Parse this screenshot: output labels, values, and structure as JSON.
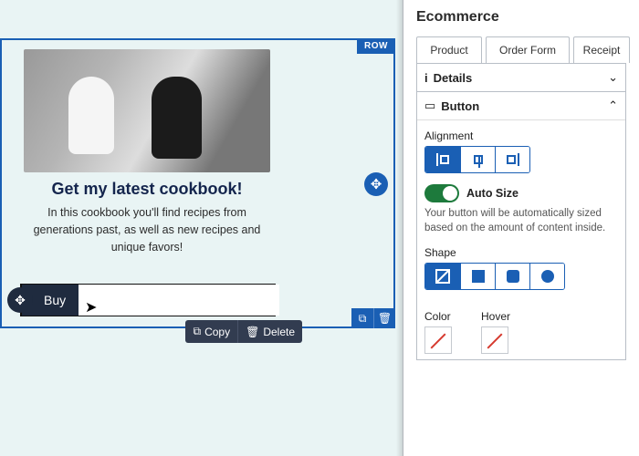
{
  "canvas": {
    "row_tag": "ROW",
    "headline": "Get my latest cookbook!",
    "subtext": "In this cookbook you'll find recipes from generations past, as well as new recipes and unique favors!",
    "buy_label": "Buy",
    "copy_label": "Copy",
    "delete_label": "Delete"
  },
  "sidebar": {
    "panel_title": "Ecommerce",
    "tabs": {
      "product": "Product",
      "order_form": "Order Form",
      "receipt": "Receipt"
    },
    "details_label": "Details",
    "button_label": "Button",
    "alignment_label": "Alignment",
    "auto_size_label": "Auto Size",
    "auto_size_help": "Your button will be automatically sized based on the amount of content inside.",
    "shape_label": "Shape",
    "color_label": "Color",
    "hover_label": "Hover"
  }
}
